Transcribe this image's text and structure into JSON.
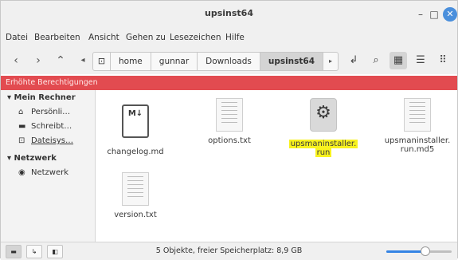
{
  "window": {
    "title": "upsinst64"
  },
  "menu": [
    "Datei",
    "Bearbeiten",
    "Ansicht",
    "Gehen zu",
    "Lesezeichen",
    "Hilfe"
  ],
  "breadcrumbs": [
    "home",
    "gunnar",
    "Downloads",
    "upsinst64"
  ],
  "banner": "Erhöhte Berechtigungen",
  "sidebar": {
    "sections": [
      {
        "title": "Mein Rechner",
        "items": [
          {
            "label": "Persönli…",
            "icon": "home-icon"
          },
          {
            "label": "Schreibt…",
            "icon": "desktop-icon"
          },
          {
            "label": "Dateisys…",
            "icon": "drive-icon"
          }
        ]
      },
      {
        "title": "Netzwerk",
        "items": [
          {
            "label": "Netzwerk",
            "icon": "network-icon"
          }
        ]
      }
    ]
  },
  "files": [
    {
      "name": "changelog.md",
      "type": "markdown",
      "icon_text": "M↓"
    },
    {
      "name": "options.txt",
      "type": "text"
    },
    {
      "name_line1": "upsmaninstaller.",
      "name_line2": "run",
      "type": "executable",
      "selected": true
    },
    {
      "name_line1": "upsmaninstaller.",
      "name_line2": "run.md5",
      "type": "text"
    },
    {
      "name": "version.txt",
      "type": "text"
    }
  ],
  "status": {
    "text": "5 Objekte, freier Speicherplatz: 8,9 GB",
    "zoom_level": 0.6
  },
  "colors": {
    "banner": "#e24b50",
    "highlight": "#f8f21f",
    "accent": "#3584e4"
  }
}
